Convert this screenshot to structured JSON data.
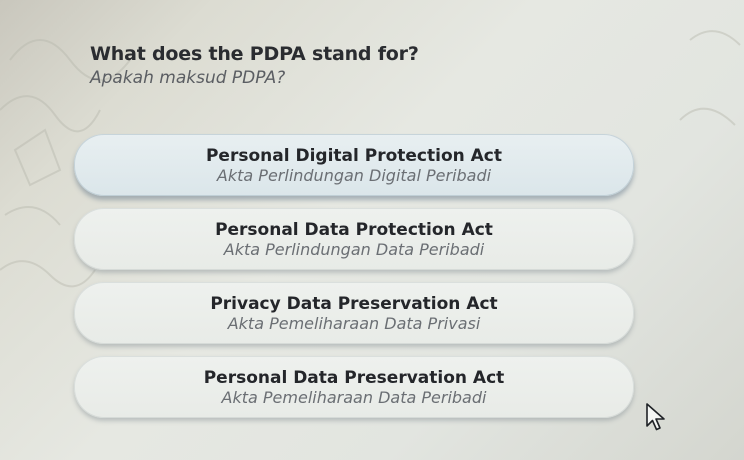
{
  "question": {
    "title": "What does the PDPA stand for?",
    "subtitle": "Apakah maksud PDPA?"
  },
  "options": [
    {
      "en": "Personal Digital Protection Act",
      "ms": "Akta Perlindungan Digital Peribadi"
    },
    {
      "en": "Personal Data Protection Act",
      "ms": "Akta Perlindungan Data Peribadi"
    },
    {
      "en": "Privacy Data Preservation Act",
      "ms": "Akta Pemeliharaan Data Privasi"
    },
    {
      "en": "Personal Data Preservation Act",
      "ms": "Akta Pemeliharaan Data Peribadi"
    }
  ],
  "icons": {
    "cursor": "mouse-pointer-icon"
  }
}
